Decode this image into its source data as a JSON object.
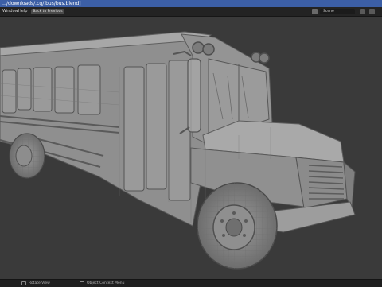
{
  "window": {
    "title": "…/downloads/.cg/.bus/bus.blend]"
  },
  "menubar": {
    "items": [
      "Window",
      "Help"
    ],
    "back_to_previous": "Back to Previous",
    "scene_label": "Scene"
  },
  "statusbar": {
    "left": "Rotate View",
    "middle": "Object Context Menu"
  },
  "colors": {
    "title_bar": "#3c5fa6",
    "viewport_bg": "#3a3a3a",
    "mesh_face": "#8c8c8c",
    "wire": "#4a4a4a"
  },
  "icons": [
    "scene-icon",
    "view-layer-icon",
    "mouse-icon"
  ]
}
